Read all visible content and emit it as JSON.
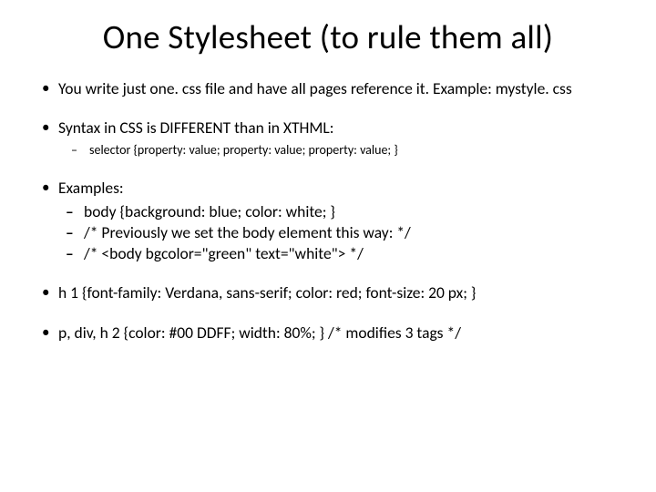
{
  "title": "One Stylesheet (to rule them all)",
  "bullets": {
    "b1": "You write just one. css file and have all pages reference it.  Example: mystyle. css",
    "b2": {
      "text": "Syntax in CSS is DIFFERENT than in XTHML:",
      "sub": "selector {property: value; property: value; property: value; }"
    },
    "b3": {
      "text": "Examples:",
      "sub1": "body {background: blue; color: white; }",
      "sub2": "/* Previously we set the body element this way: */",
      "sub3": "/* <body bgcolor=\"green\" text=\"white\"> */"
    },
    "b4": "h 1 {font-family: Verdana, sans-serif; color: red; font-size: 20 px; }",
    "b5": "p, div, h 2 {color: #00 DDFF; width: 80%; } /* modifies 3 tags */"
  }
}
